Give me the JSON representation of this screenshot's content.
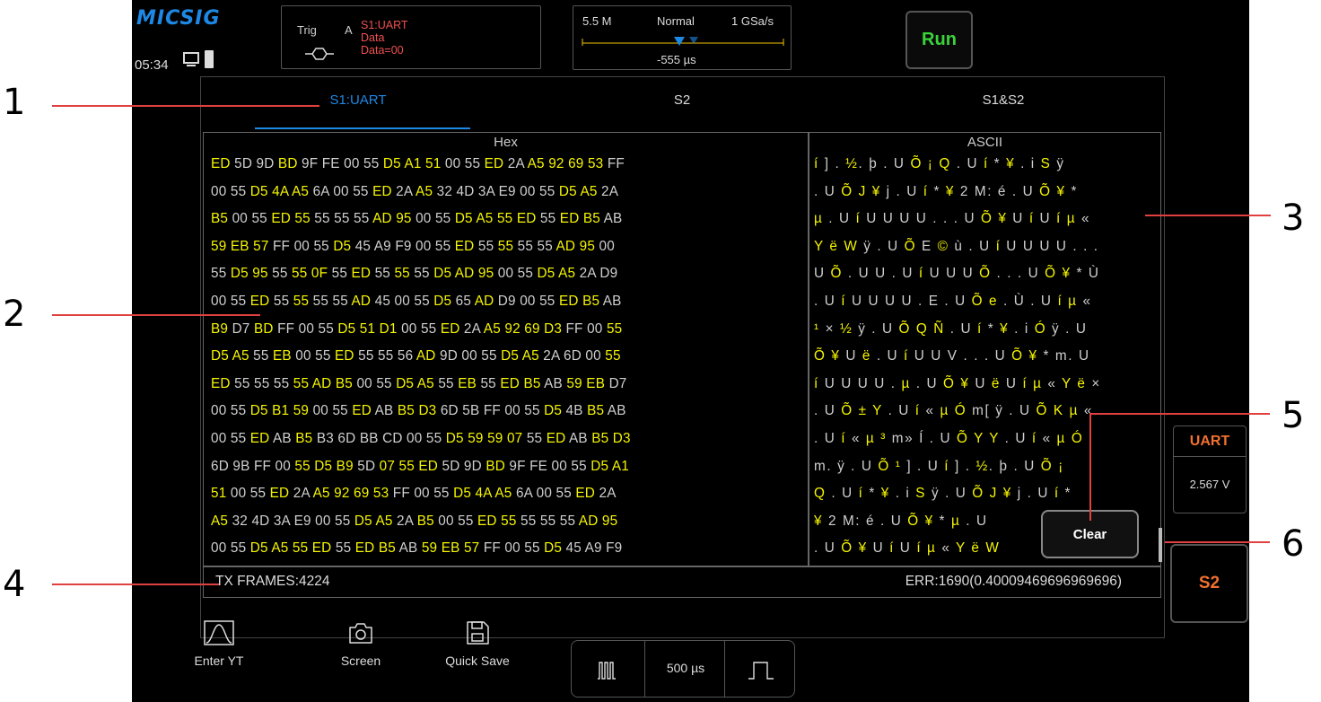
{
  "brand": "MICSIG",
  "status": {
    "time": "05:34"
  },
  "trigger": {
    "label": "Trig",
    "channel": "A",
    "line1": "S1:UART",
    "line2": "Data",
    "line3": "Data=00"
  },
  "acquisition": {
    "memory": "5.5 M",
    "mode": "Normal",
    "rate": "1 GSa/s",
    "offset": "-555 µs"
  },
  "run_label": "Run",
  "tabs": [
    {
      "label": "S1:UART"
    },
    {
      "label": "S2"
    },
    {
      "label": "S1&S2"
    }
  ],
  "columns": {
    "hex": "Hex",
    "ascii": "ASCII"
  },
  "hex_rows": [
    "ED 5D 9D BD 9F FE 00 55 D5 A1 51 00 55 ED 2A A5 92 69 53 FF",
    "00 55 D5 4A A5 6A 00 55 ED 2A A5 32 4D 3A E9 00 55 D5 A5 2A",
    "B5 00 55 ED 55 55 55 55 AD 95 00 55 D5 A5 55 ED 55 ED B5 AB",
    "59 EB 57 FF 00 55 D5 45 A9 F9 00 55 ED 55 55 55 55 AD 95 00",
    "55 D5 95 55 55 0F 55 ED 55 55 55 D5 AD 95 00 55 D5 A5 2A D9",
    "00 55 ED 55 55 55 55 AD 45 00 55 D5 65 AD D9 00 55 ED B5 AB",
    "B9 D7 BD FF 00 55 D5 51 D1 00 55 ED 2A A5 92 69 D3 FF 00 55",
    "D5 A5 55 EB 00 55 ED 55 55 56 AD 9D 00 55 D5 A5 2A 6D 00 55",
    "ED 55 55 55 55 AD B5 00 55 D5 A5 55 EB 55 ED B5 AB 59 EB D7",
    "00 55 D5 B1 59 00 55 ED AB B5 D3 6D 5B FF 00 55 D5 4B B5 AB",
    "00 55 ED AB B5 B3 6D BB CD 00 55 D5 59 59 07 55 ED AB B5 D3",
    "6D 9B FF 00 55 D5 B9 5D 07 55 ED 5D 9D BD 9F FE 00 55 D5 A1",
    "51 00 55 ED 2A A5 92 69 53 FF 00 55 D5 4A A5 6A 00 55 ED 2A",
    "A5 32 4D 3A E9 00 55 D5 A5 2A B5 00 55 ED 55 55 55 55 AD 95",
    "00 55 D5 A5 55 ED 55 ED B5 AB 59 EB 57 FF 00 55 D5 45 A9 F9"
  ],
  "ascii_rows": [
    "í ] . ½. þ . U Õ ¡ Q . U í * ¥ . i S ÿ",
    ". U Õ J ¥ j . U í * ¥ 2 M: é . U Õ ¥ *",
    "µ . U í U U U U . . . U Õ ¥ U í U í µ «",
    "Y ë W ÿ . U Õ E © ù . U í U U U U . . .",
    "U Õ . U U . U í U U U Õ . . . U Õ ¥ * Ù",
    ". U í U U U U . E . U Õ e . Ù . U í µ «",
    "¹ × ½ ÿ . U Õ Q Ñ . U í * ¥ . i Ó ÿ . U",
    "Õ ¥ U ë . U í U U V . . . U Õ ¥ * m. U",
    "í U U U U . µ . U Õ ¥ U ë U í µ « Y ë ×",
    ". U Õ ± Y . U í « µ Ó m[ ÿ . U Õ K µ «",
    ". U í « µ ³ m» Í . U Õ Y Y . U í « µ Ó",
    "m. ÿ . U Õ ¹ ] . U í ] . ½. þ . U Õ ¡",
    "Q . U í * ¥ . i S ÿ . U Õ J ¥ j . U í *",
    "¥ 2 M: é . U Õ ¥ * µ . U",
    ". U Õ ¥ U í U í µ « Y ë W"
  ],
  "tx_frames": "TX FRAMES:4224",
  "err": "ERR:1690(0.40009469696969696)",
  "clear_label": "Clear",
  "side_panel": {
    "title": "UART",
    "voltage": "2.567 V",
    "s2": "S2"
  },
  "bottom": {
    "enter_yt": "Enter YT",
    "screen": "Screen",
    "quick_save": "Quick Save",
    "timebase": "500 µs"
  },
  "annotations": [
    "1",
    "2",
    "3",
    "4",
    "5",
    "6"
  ],
  "colors": {
    "accent": "#1e88e5",
    "highlight": "#f5f500",
    "run": "#3bd43b",
    "trigger": "#f05050",
    "orange": "#f07030",
    "callout_line": "#e04040"
  }
}
